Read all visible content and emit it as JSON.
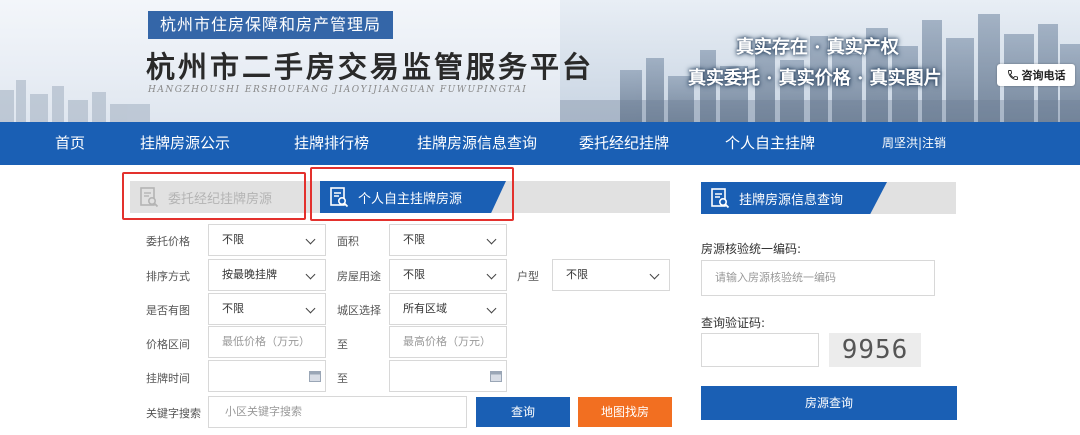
{
  "banner": {
    "bureau": "杭州市住房保障和房产管理局",
    "title": "杭州市二手房交易监管服务平台",
    "pinyin": "HANGZHOUSHI ERSHOUFANG JIAOYIJIANGUAN FUWUPINGTAI",
    "slogan_1": "真实存在 · 真实产权",
    "slogan_2": "真实委托 · 真实价格 · 真实图片",
    "hotline": "咨询电话"
  },
  "nav": {
    "items": [
      "首页",
      "挂牌房源公示",
      "挂牌排行榜",
      "挂牌房源信息查询",
      "委托经纪挂牌",
      "个人自主挂牌"
    ],
    "user": "周坚洪|注销"
  },
  "tabs": {
    "agent": "委托经纪挂牌房源",
    "personal": "个人自主挂牌房源"
  },
  "form": {
    "price_label": "委托价格",
    "price_value": "不限",
    "area_label": "面积",
    "area_value": "不限",
    "sort_label": "排序方式",
    "sort_value": "按最晚挂牌",
    "usage_label": "房屋用途",
    "usage_value": "不限",
    "layout_label": "户型",
    "layout_value": "不限",
    "photo_label": "是否有图",
    "photo_value": "不限",
    "district_label": "城区选择",
    "district_value": "所有区域",
    "range_label": "价格区间",
    "min_price_placeholder": "最低价格（万元）",
    "to_1": "至",
    "max_price_placeholder": "最高价格（万元）",
    "time_label": "挂牌时间",
    "to_2": "至",
    "keyword_label": "关键字搜索",
    "keyword_placeholder": "小区关键字搜索",
    "search_button": "查询",
    "map_button": "地图找房"
  },
  "lookup": {
    "tab": "挂牌房源信息查询",
    "code_label": "房源核验统一编码:",
    "code_placeholder": "请输入房源核验统一编码",
    "verify_label": "查询验证码:",
    "captcha": "9956",
    "submit": "房源查询"
  },
  "colors": {
    "nav_blue": "#1a5fb4",
    "map_button_orange": "#f26f21",
    "highlight_red": "#e3312d"
  }
}
